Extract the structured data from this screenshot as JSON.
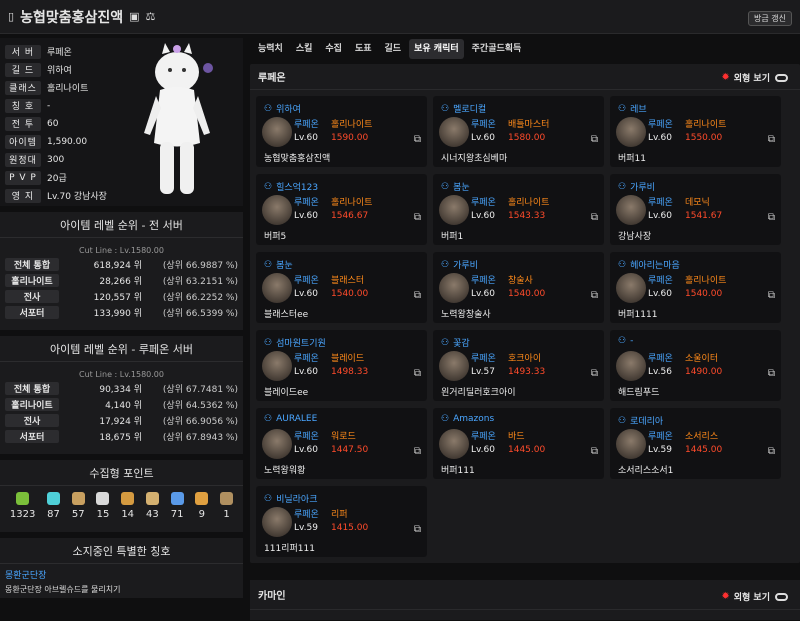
{
  "header": {
    "title": "농협맞춤홍삼진액",
    "refresh_label": "방금 갱신",
    "id_icon": "id-card-icon",
    "compare_icon": "balance-scale-icon",
    "bookmark_icon": "bookmark-icon"
  },
  "profile": {
    "rows": [
      {
        "label": "서 버",
        "value": "루페온"
      },
      {
        "label": "길 드",
        "value": "위하여"
      },
      {
        "label": "클래스",
        "value": "홀리나이트"
      },
      {
        "label": "칭 호",
        "value": "-"
      },
      {
        "label": "전 투",
        "value": "60"
      },
      {
        "label": "아이템",
        "value": "1,590.00"
      },
      {
        "label": "원정대",
        "value": "300"
      },
      {
        "label": "P V P",
        "value": "20급"
      },
      {
        "label": "영 지",
        "value": "Lv.70 강남사장"
      }
    ]
  },
  "rank_all": {
    "title": "아이템 레벨 순위 - 전 서버",
    "cut": "Cut Line : Lv.1580.00",
    "rows": [
      {
        "label": "전체 통합",
        "rank": "618,924 위",
        "pct": "(상위 66.9887 %)"
      },
      {
        "label": "홀리나이트",
        "rank": "28,266 위",
        "pct": "(상위 63.2151 %)"
      },
      {
        "label": "전사",
        "rank": "120,557 위",
        "pct": "(상위 66.2252 %)"
      },
      {
        "label": "서포터",
        "rank": "133,990 위",
        "pct": "(상위 66.5399 %)"
      }
    ]
  },
  "rank_server": {
    "title": "아이템 레벨 순위 - 루페온 서버",
    "cut": "Cut Line : Lv.1580.00",
    "rows": [
      {
        "label": "전체 통합",
        "rank": "90,334 위",
        "pct": "(상위 67.7481 %)"
      },
      {
        "label": "홀리나이트",
        "rank": "4,140 위",
        "pct": "(상위 64.5362 %)"
      },
      {
        "label": "전사",
        "rank": "17,924 위",
        "pct": "(상위 66.9056 %)"
      },
      {
        "label": "서포터",
        "rank": "18,675 위",
        "pct": "(상위 67.8943 %)"
      }
    ]
  },
  "collect": {
    "title": "수집형 포인트",
    "items": [
      {
        "icon": "mokoko-seed-icon",
        "value": "1323",
        "color": "#7bbf3a"
      },
      {
        "icon": "island-heart-icon",
        "value": "87",
        "color": "#4fd0d8"
      },
      {
        "icon": "great-art-icon",
        "value": "57",
        "color": "#c8a060"
      },
      {
        "icon": "giant-heart-icon",
        "value": "15",
        "color": "#d9d9d9"
      },
      {
        "icon": "ignea-token-icon",
        "value": "14",
        "color": "#d49a40"
      },
      {
        "icon": "voyage-icon",
        "value": "43",
        "color": "#d4b070"
      },
      {
        "icon": "world-tree-leaf-icon",
        "value": "71",
        "color": "#5a9ae8"
      },
      {
        "icon": "orpheus-star-icon",
        "value": "9",
        "color": "#e0a040"
      },
      {
        "icon": "sea-bounty-icon",
        "value": "1",
        "color": "#b09060"
      }
    ]
  },
  "titles": {
    "heading": "소지중인 특별한 칭호",
    "name": "몽환군단장",
    "desc": "몽환군단장 아브렐슈드를 물리치기"
  },
  "tabs": [
    "능력치",
    "스킬",
    "수집",
    "도표",
    "길드",
    "보유 캐릭터",
    "주간골드획득"
  ],
  "active_tab": 5,
  "server_section": {
    "name": "루페온",
    "toggle_label": "외형 보기",
    "characters": [
      {
        "name": "위하여",
        "server": "루페온",
        "class": "홀리나이트",
        "level": "Lv.60",
        "ilvl": "1590.00",
        "guild": "농협맞춤홍삼진액"
      },
      {
        "name": "멜로디컬",
        "server": "루페온",
        "class": "배틀마스터",
        "level": "Lv.60",
        "ilvl": "1580.00",
        "guild": "시너지왕초심베마"
      },
      {
        "name": "레브",
        "server": "루페온",
        "class": "홀리나이트",
        "level": "Lv.60",
        "ilvl": "1550.00",
        "guild": "버퍼11"
      },
      {
        "name": "힐스억123",
        "server": "루페온",
        "class": "홀리나이트",
        "level": "Lv.60",
        "ilvl": "1546.67",
        "guild": "버퍼5"
      },
      {
        "name": "봄눈",
        "server": "루페온",
        "class": "홀리나이트",
        "level": "Lv.60",
        "ilvl": "1543.33",
        "guild": "버퍼1"
      },
      {
        "name": "가루비",
        "server": "루페온",
        "class": "데모닉",
        "level": "Lv.60",
        "ilvl": "1541.67",
        "guild": "강남사장"
      },
      {
        "name": "봄눈",
        "server": "루페온",
        "class": "블래스터",
        "level": "Lv.60",
        "ilvl": "1540.00",
        "guild": "블래스터ee"
      },
      {
        "name": "가루비",
        "server": "루페온",
        "class": "창술사",
        "level": "Lv.60",
        "ilvl": "1540.00",
        "guild": "노력왕창술사"
      },
      {
        "name": "헤아리는마음",
        "server": "루페온",
        "class": "홀리나이트",
        "level": "Lv.60",
        "ilvl": "1540.00",
        "guild": "버퍼1111"
      },
      {
        "name": "섬마원트기원",
        "server": "루페온",
        "class": "블레이드",
        "level": "Lv.60",
        "ilvl": "1498.33",
        "guild": "블레이드ee"
      },
      {
        "name": "꽃감",
        "server": "루페온",
        "class": "호크아이",
        "level": "Lv.57",
        "ilvl": "1493.33",
        "guild": "왼거리딜러호크아이"
      },
      {
        "name": "-",
        "server": "루페온",
        "class": "소울이터",
        "level": "Lv.56",
        "ilvl": "1490.00",
        "guild": "해드림푸드"
      },
      {
        "name": "AURALEE",
        "server": "루페온",
        "class": "워로드",
        "level": "Lv.60",
        "ilvl": "1447.50",
        "guild": "노력왕워황"
      },
      {
        "name": "Amazons",
        "server": "루페온",
        "class": "바드",
        "level": "Lv.60",
        "ilvl": "1445.00",
        "guild": "버퍼111"
      },
      {
        "name": "로데리아",
        "server": "루페온",
        "class": "소서리스",
        "level": "Lv.59",
        "ilvl": "1445.00",
        "guild": "소서리스소서1"
      },
      {
        "name": "비닐라아크",
        "server": "루페온",
        "class": "리퍼",
        "level": "Lv.59",
        "ilvl": "1415.00",
        "guild": "111리퍼111"
      }
    ]
  },
  "second_section": {
    "name": "카마인",
    "toggle_label": "외형 보기"
  }
}
